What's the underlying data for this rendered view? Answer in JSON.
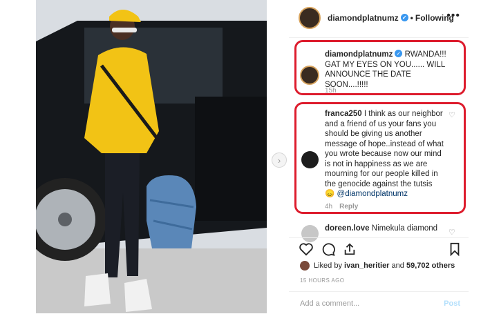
{
  "post": {
    "username": "diamondplatnumz",
    "follow_status": "Following",
    "dot": "•",
    "more": "•••"
  },
  "caption": {
    "username": "diamondplatnumz",
    "text": "RWANDA!!! GAT MY EYES ON YOU...... WILL ANNOUNCE THE DATE SOON....!!!!!",
    "time": "15h"
  },
  "comments": [
    {
      "username": "franca250",
      "text": "I think as our neighbor and a friend of us your fans you should be giving us another message of hope..instead of what you wrote because now our mind is not in happiness as we are mourning for our people killed in the genocide against the tutsis",
      "emoji": "😞",
      "mention": "@diamondplatnumz",
      "time": "4h",
      "reply": "Reply"
    },
    {
      "username": "doreen.love",
      "text": "Nimekula diamond"
    }
  ],
  "likes": {
    "prefix": "Liked by",
    "user": "ivan_heritier",
    "and": "and",
    "others": "59,702 others"
  },
  "timestamp": "15 HOURS AGO",
  "comment_box": {
    "placeholder": "Add a comment...",
    "post_label": "Post"
  },
  "colors": {
    "highlight_box": "#dd1c2d",
    "verified": "#3897f0",
    "hoodie": "#f2c315"
  }
}
